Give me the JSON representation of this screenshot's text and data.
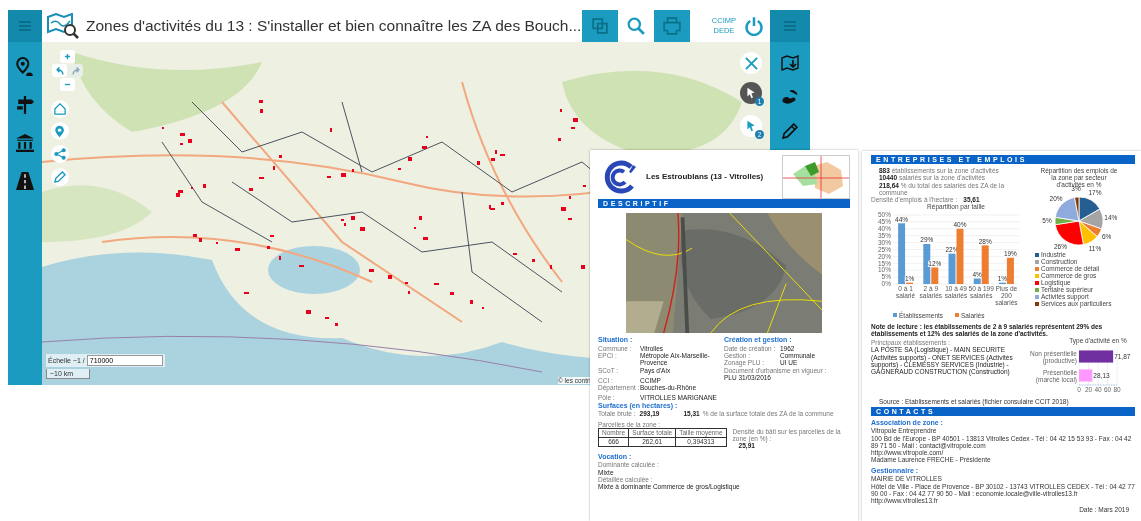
{
  "header": {
    "title": "Zones d'activités du 13 : S'installer et bien connaître les ZA des Bouch...",
    "user": [
      "CCIMP",
      "DEDE"
    ]
  },
  "map": {
    "scale_label": "Échelle ~1 /",
    "scale_value": "710000",
    "scale_bar": "~10 km",
    "attribution": "© les contri",
    "badges": [
      "1",
      "2"
    ]
  },
  "sheet_1": {
    "title": "Les Estroublans (13 - Vitrolles)",
    "section": "DESCRIPTIF",
    "situation": {
      "heading": "Situation :",
      "fields": [
        {
          "kind": "inline",
          "label": "Commune :",
          "value": "Vitrolles"
        },
        {
          "kind": "inline",
          "label": "EPCI :",
          "value": "Métropole Aix-Marseille-Provence"
        },
        {
          "kind": "inline",
          "label": "SCoT :",
          "value": "Pays d'Aix"
        },
        {
          "kind": "inline",
          "label": "CCI :",
          "value": "CCIMP"
        },
        {
          "kind": "inline",
          "label": "Département :",
          "value": "Bouches-du-Rhône"
        },
        {
          "kind": "inline",
          "label": "Pôle :",
          "value": "VITROLLES MARIGNANE"
        }
      ]
    },
    "creation": {
      "heading": "Création et gestion :",
      "fields": [
        {
          "kind": "inline",
          "label": "Date de création :",
          "value": "1962"
        },
        {
          "kind": "inline",
          "label": "Gestion :",
          "value": "Communale"
        },
        {
          "kind": "inline",
          "label": "Zonage PLU :",
          "value": "UI UE"
        },
        {
          "kind": "stacked",
          "label": "Document d'urbanisme en vigueur :",
          "value": "PLU 31/03/2016"
        }
      ]
    },
    "surfaces": {
      "heading": "Surfaces (en hectares) :",
      "total_label": "Totale brute :",
      "total_value": "293,19",
      "share_value": "15,31",
      "share_label": "% de la surface totale des ZA de la commune"
    },
    "parcels": {
      "label": "Parcelles de la zone :",
      "columns": [
        "Nombre",
        "Surface totale",
        "Taille moyenne"
      ],
      "row": [
        "666",
        "262,61",
        "0,394313"
      ],
      "density_label": "Densité du bâti sur les parcelles de la zone (en %) :",
      "density_value": "25,91"
    },
    "vocation": {
      "heading": "Vocation :",
      "fields": [
        {
          "kind": "stacked",
          "label": "Dominante calculée :",
          "value": "Mixte"
        },
        {
          "kind": "stacked",
          "label": "Détaillée calculée :",
          "value": "Mixte à dominante Commerce de gros/Logistique"
        }
      ]
    }
  },
  "sheet_2": {
    "section": "ENTREPRISES ET EMPLOIS",
    "stats": [
      "**883** établissements sur la zone d'activités",
      "**10440** salariés sur la zone d'activités",
      "**218,64** % du total des salariés des ZA de la commune"
    ],
    "density": {
      "label": "Densité d'emplois à l'hectare :",
      "value": "35,61"
    },
    "size_chart": {
      "chart_data": {
        "type": "bar",
        "title": "Répartition par taille",
        "categories": [
          "0 à 1 salarié",
          "2 à 9 salariés",
          "10 à 49 salariés",
          "50 à 199 salariés",
          "Plus de 200 salariés"
        ],
        "series": [
          {
            "name": "Établissements",
            "color": "#5b9bd5",
            "values": [
              44,
              29,
              22,
              4,
              1
            ],
            "value_labels": [
              "44%",
              "29%",
              "22%",
              "4%",
              "1%"
            ]
          },
          {
            "name": "Salariés",
            "color": "#ed7d31",
            "values": [
              1,
              12,
              40,
              28,
              19
            ],
            "value_labels": [
              "1%",
              "12%",
              "40%",
              "28%",
              "19%"
            ]
          }
        ],
        "grid": true,
        "legend": "bottom",
        "ylim": [
          0,
          50
        ],
        "yticks": [
          {
            "value": 0,
            "label": "0%"
          },
          {
            "value": 5,
            "label": "5%"
          },
          {
            "value": 10,
            "label": "10%"
          },
          {
            "value": 15,
            "label": "15%"
          },
          {
            "value": 20,
            "label": "20%"
          },
          {
            "value": 25,
            "label": "25%"
          },
          {
            "value": 30,
            "label": "30%"
          },
          {
            "value": 35,
            "label": "35%"
          },
          {
            "value": 40,
            "label": "40%"
          },
          {
            "value": 45,
            "label": "45%"
          },
          {
            "value": 50,
            "label": "50%"
          }
        ]
      }
    },
    "sector_chart": {
      "chart_data": {
        "type": "pie",
        "title": "Répartition des emplois de la zone par secteur d'activités en %",
        "categories": [
          "Industrie",
          "Construction",
          "Commerce de détail",
          "Commerce de gros",
          "Logistique",
          "Tertiaire supérieur",
          "Activités support",
          "Services aux particuliers"
        ],
        "values": [
          17,
          14,
          6,
          11,
          26,
          5,
          20,
          3
        ],
        "value_labels": [
          "17%",
          "14%",
          "6%",
          "11%",
          "26%",
          "5%",
          "20%",
          "3%"
        ],
        "colors": [
          "#255e91",
          "#a5a5a5",
          "#ed7d31",
          "#ffc000",
          "#ff0000",
          "#70ad47",
          "#8faadc",
          "#843c0c"
        ],
        "legend": "bottom"
      }
    },
    "note": "Note de lecture : les établissements de 2 à 9 salariés représentent 29% des établissements et 12% des salariés de la zone d'activités.",
    "main_label": "Principaux établissements :",
    "main_list": "LA POSTE SA (Logistique) - MAIN SECURITE (Activités supports) - ONET SERVICES (Activités supports) - CLEMESSY SERVICES (Industrie) - GAGNERAUD CONSTRUCTION (Construction)",
    "type_chart": {
      "chart_data": {
        "type": "bar",
        "orientation": "horizontal",
        "title": "Type d'activité en %",
        "categories": [
          "Non présentielle (productive)",
          "Présentielle (marché local)"
        ],
        "values": [
          71.87,
          28.13
        ],
        "colors": [
          "#7030a0",
          "#ff99ff"
        ],
        "value_labels": [
          "71,87",
          "28,13"
        ],
        "xlim": [
          0,
          80
        ],
        "xticks": [
          0,
          20,
          40,
          60,
          80
        ],
        "grid": true
      }
    },
    "source": "Source : Etablissements et salariés (fichier consulaire CCIT 2018)",
    "contacts_section": "CONTACTS",
    "association": {
      "heading": "Association de zone :",
      "lines": [
        "Vitropole Entreprendre",
        "100 Bd de l'Europe - BP 40501 - 13813 Vitrolles Cedex - Tél : 04 42 15 53 93 - Fax : 04 42 89 71 50 - Mail : contact@vitropole.com",
        "http://www.vitropole.com/",
        "Madame Laurence FRECHE - Présidente"
      ]
    },
    "manager": {
      "heading": "Gestionnaire :",
      "lines": [
        "MAIRIE DE VITROLLES",
        "Hôtel de Ville - Place de Provence - BP 30102 - 13743 VITROLLES CEDEX - Tél : 04 42 77 90 00 - Fax : 04 42 77 90 50 - Mail : economie.locale@ville-vitrolles13.fr",
        "http://www.vitrolles13.fr"
      ]
    },
    "date": "Date : Mars 2019"
  }
}
